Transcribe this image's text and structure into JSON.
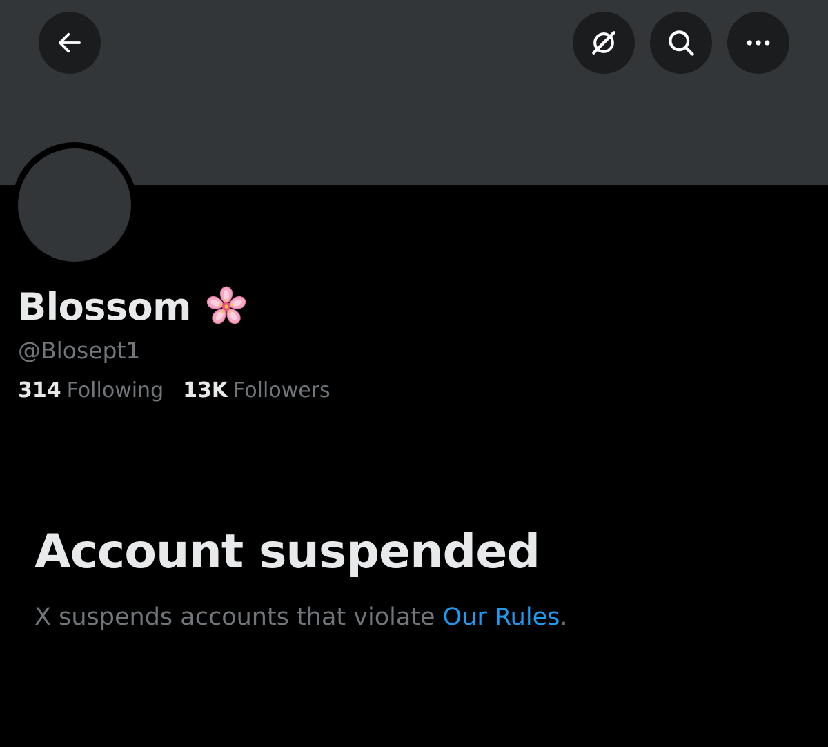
{
  "header": {
    "back_icon": "arrow-left-icon",
    "grok_icon": "grok-slash-icon",
    "search_icon": "search-icon",
    "more_icon": "more-dots-icon"
  },
  "profile": {
    "name": "Blossom",
    "name_emoji": "cherry-blossom",
    "handle": "@Blosept1",
    "following_count": "314",
    "following_label": "Following",
    "followers_count": "13K",
    "followers_label": "Followers"
  },
  "suspension": {
    "title": "Account suspended",
    "message_prefix": "X suspends accounts that violate ",
    "link_text": "Our Rules",
    "message_suffix": "."
  },
  "colors": {
    "background": "#000000",
    "banner": "#333639",
    "primary_text": "#e7e9ea",
    "secondary_text": "#71767b",
    "link": "#1d9bf0"
  }
}
